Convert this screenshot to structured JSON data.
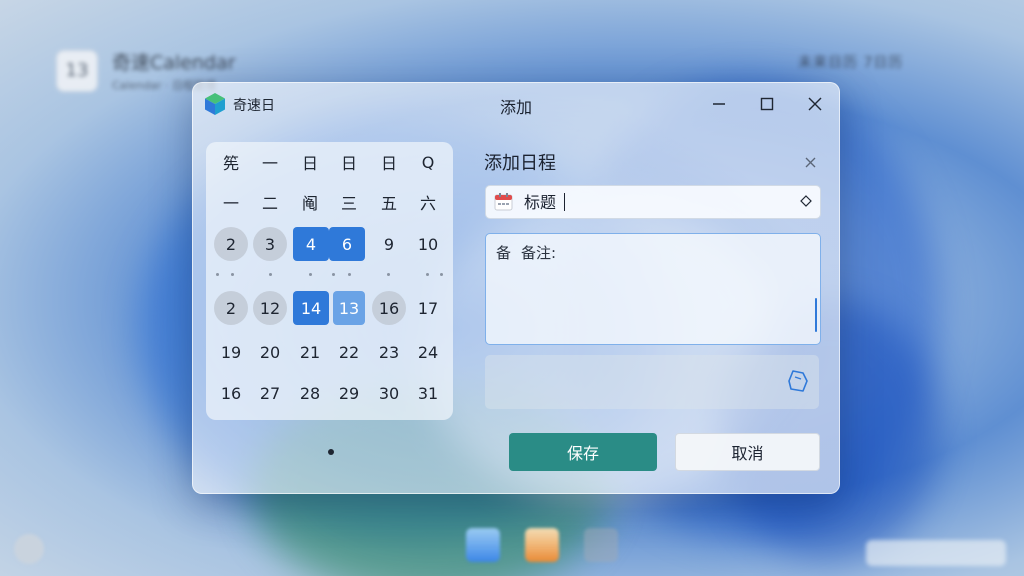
{
  "background": {
    "app_title": "奇速Calendar",
    "app_subtitle": "Calendar · 日程管理",
    "app_icon_number": "13",
    "top_right": "未来日历  7日历"
  },
  "window": {
    "app_name": "奇速日",
    "title": "添加",
    "controls": [
      "minimize",
      "maximize",
      "close"
    ]
  },
  "calendar": {
    "weekday_row_1": [
      "筅",
      "一",
      "日",
      "日",
      "日",
      "Q"
    ],
    "weekday_row_2": [
      "一",
      "二",
      "阄",
      "三",
      "五",
      "六"
    ],
    "row_a": [
      "2",
      "3",
      "4",
      "6",
      "9",
      "10"
    ],
    "row_b": [
      "2",
      "12",
      "14",
      "13",
      "16",
      "17"
    ],
    "row_c": [
      "19",
      "20",
      "21",
      "22",
      "23",
      "24"
    ],
    "row_d": [
      "16",
      "27",
      "28",
      "29",
      "30",
      "31"
    ],
    "accent_color": "#2f79d9"
  },
  "form": {
    "heading": "添加日程",
    "title_value": "标题",
    "notes_prefix": "备",
    "notes_label": "备注:",
    "save_label": "保存",
    "cancel_label": "取消",
    "save_color": "#2a8c86"
  }
}
